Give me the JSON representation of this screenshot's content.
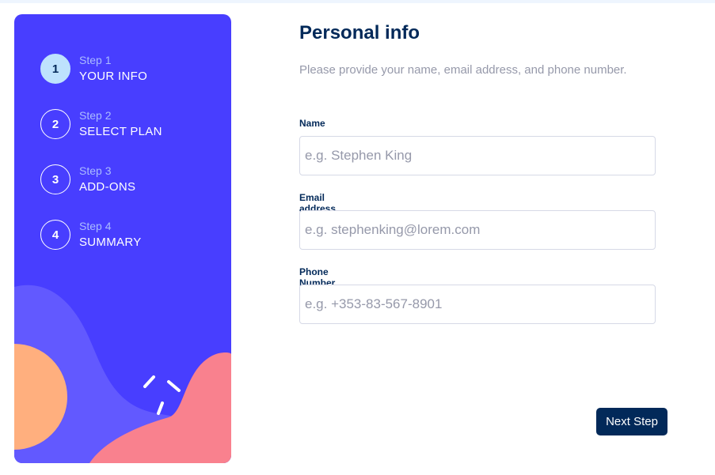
{
  "sidebar": {
    "steps": [
      {
        "number": "1",
        "label": "Step 1",
        "title": "YOUR INFO"
      },
      {
        "number": "2",
        "label": "Step 2",
        "title": "SELECT PLAN"
      },
      {
        "number": "3",
        "label": "Step 3",
        "title": "ADD-ONS"
      },
      {
        "number": "4",
        "label": "Step 4",
        "title": "SUMMARY"
      }
    ],
    "active_step": 1
  },
  "form": {
    "title": "Personal info",
    "subtitle": "Please provide your name, email address, and phone number.",
    "fields": [
      {
        "label": "Name",
        "placeholder": "e.g. Stephen King"
      },
      {
        "label": "Email address",
        "placeholder": "e.g. stephenking@lorem.com"
      },
      {
        "label": "Phone Number",
        "placeholder": "e.g. +353-83-567-8901"
      }
    ]
  },
  "next_button": "Next Step",
  "colors": {
    "sidebar_bg": "#483eff",
    "active_step_bg": "#bee2fd",
    "marine_blue": "#022959",
    "blob_orange": "#ffaf7e",
    "blob_pink": "#f9818e",
    "blob_purple": "#6259ff",
    "input_border": "#d6d9e6",
    "cool_gray": "#9699aa"
  }
}
